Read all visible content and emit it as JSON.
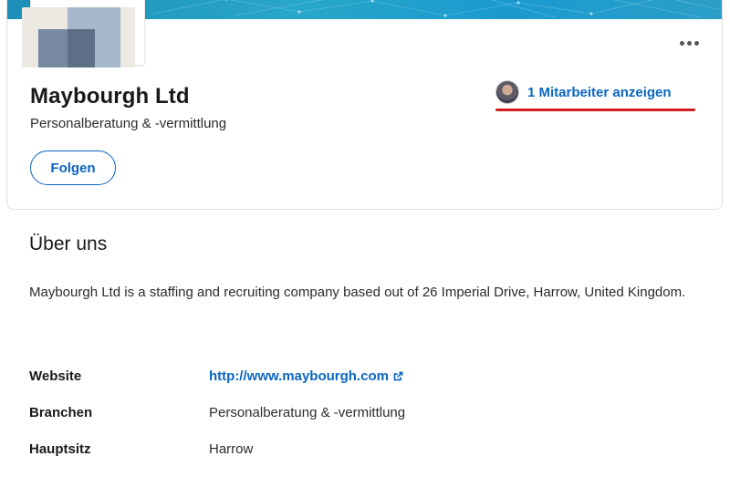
{
  "company": {
    "name": "Maybourgh Ltd",
    "industry": "Personalberatung & -vermittlung",
    "follow_label": "Folgen",
    "employees_label": "1 Mitarbeiter anzeigen"
  },
  "colors": {
    "accent": "#0a66c2",
    "annotation_underline": "#d01c1c"
  },
  "about": {
    "heading": "Über uns",
    "description": "Maybourgh Ltd is a staffing and recruiting company based out of 26 Imperial Drive, Harrow, United Kingdom.",
    "details": [
      {
        "label": "Website",
        "value": "http://www.maybourgh.com",
        "icon": "external-link-icon"
      },
      {
        "label": "Branchen",
        "value": "Personalberatung & -vermittlung"
      },
      {
        "label": "Hauptsitz",
        "value": "Harrow"
      }
    ]
  }
}
